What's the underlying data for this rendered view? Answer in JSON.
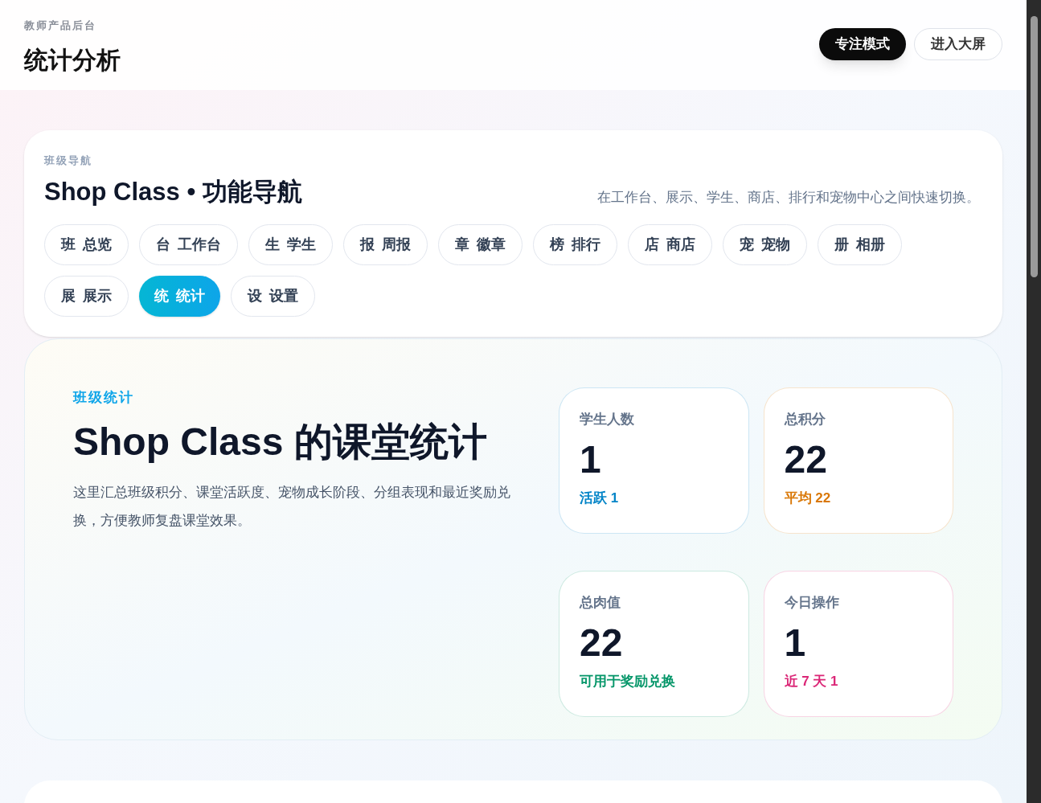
{
  "header": {
    "eyebrow": "教师产品后台",
    "title": "统计分析",
    "buttons": [
      {
        "label": "专注模式",
        "kind": "primary"
      },
      {
        "label": "进入大屏",
        "kind": "outline"
      }
    ]
  },
  "nav": {
    "eyebrow": "班级导航",
    "title": "Shop Class • 功能导航",
    "description": "在工作台、展示、学生、商店、排行和宠物中心之间快速切换。",
    "items": [
      {
        "glyph": "班",
        "label": "总览",
        "selected": false
      },
      {
        "glyph": "台",
        "label": "工作台",
        "selected": false
      },
      {
        "glyph": "生",
        "label": "学生",
        "selected": false
      },
      {
        "glyph": "报",
        "label": "周报",
        "selected": false
      },
      {
        "glyph": "章",
        "label": "徽章",
        "selected": false
      },
      {
        "glyph": "榜",
        "label": "排行",
        "selected": false
      },
      {
        "glyph": "店",
        "label": "商店",
        "selected": false
      },
      {
        "glyph": "宠",
        "label": "宠物",
        "selected": false
      },
      {
        "glyph": "册",
        "label": "相册",
        "selected": false
      },
      {
        "glyph": "展",
        "label": "展示",
        "selected": false
      },
      {
        "glyph": "统",
        "label": "统计",
        "selected": true
      },
      {
        "glyph": "设",
        "label": "设置",
        "selected": false
      }
    ]
  },
  "hero": {
    "eyebrow": "班级统计",
    "title": "Shop Class 的课堂统计",
    "description": "这里汇总班级积分、课堂活跃度、宠物成长阶段、分组表现和最近奖励兑换，方便教师复盘课堂效果。",
    "stats": [
      {
        "label": "学生人数",
        "value": "1",
        "note": "活跃 1",
        "color": "#0284c7"
      },
      {
        "label": "总积分",
        "value": "22",
        "note": "平均 22",
        "color": "#d97706"
      },
      {
        "label": "总肉值",
        "value": "22",
        "note": "可用于奖励兑换",
        "color": "#059669"
      },
      {
        "label": "今日操作",
        "value": "1",
        "note": "近 7 天 1",
        "color": "#db2777"
      }
    ]
  }
}
